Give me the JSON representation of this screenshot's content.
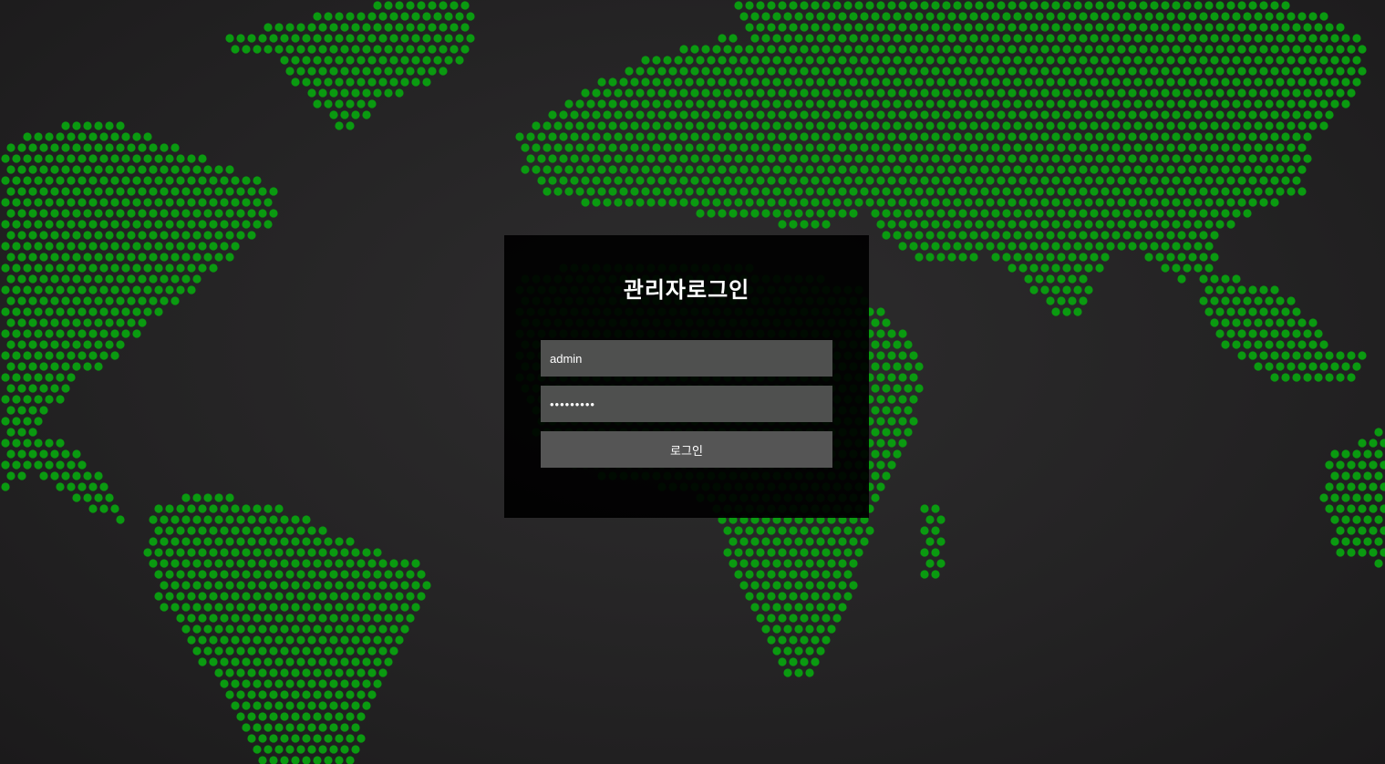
{
  "background": {
    "map_icon": "dotted-world-map",
    "dot_color": "#0a9a10",
    "base_color": "#262526"
  },
  "login": {
    "title": "관리자로그인",
    "username_value": "admin",
    "password_value": "•••••••••",
    "submit_label": "로그인"
  }
}
